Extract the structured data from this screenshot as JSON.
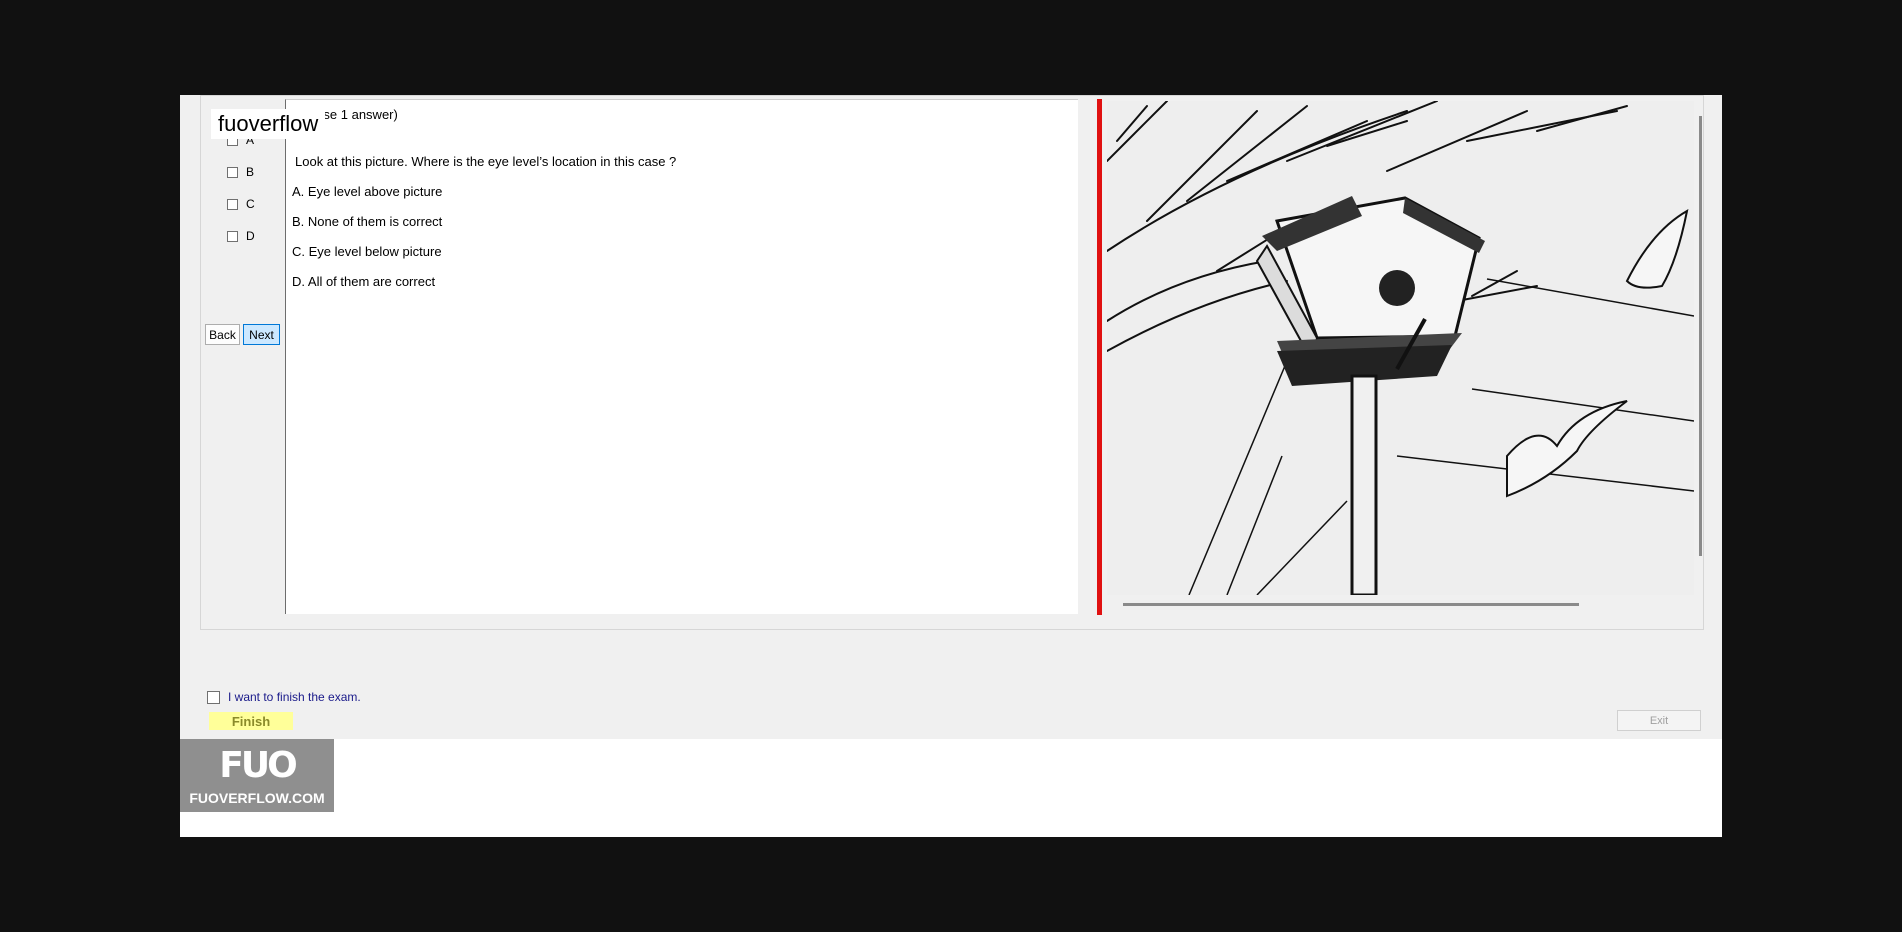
{
  "watermark": "fuoverflow",
  "answers": {
    "options": [
      {
        "label": "A"
      },
      {
        "label": "B"
      },
      {
        "label": "C"
      },
      {
        "label": "D"
      }
    ]
  },
  "nav": {
    "back": "Back",
    "next": "Next"
  },
  "question": {
    "instruction": "(Choose 1 answer)",
    "text": "Look at this picture. Where is the eye level’s location in this case ?",
    "choices": [
      "A.  Eye level above picture",
      "B.  None of them is correct",
      "C.  Eye level below picture",
      "D.  All of them are correct"
    ]
  },
  "footer": {
    "finish_label": "I want to finish the exam.",
    "finish_button": "Finish",
    "exit_button": "Exit"
  },
  "logo": {
    "mark": "FUO",
    "text": "FUOVERFLOW.COM"
  },
  "colors": {
    "splitter": "#e01111",
    "finish_bg": "#ffff99",
    "next_bg": "#cce8ff"
  }
}
